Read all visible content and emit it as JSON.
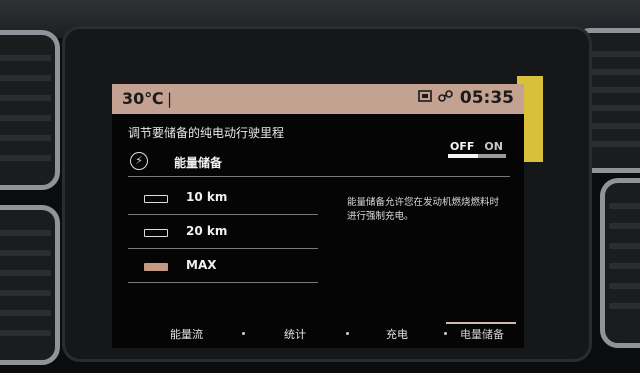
{
  "status": {
    "temperature": "30℃",
    "separator": "|",
    "time": "05:35",
    "icons": [
      "display-icon",
      "link-icon"
    ]
  },
  "title": "调节要储备的纯电动行驶里程",
  "energy_reserve": {
    "label": "能量储备",
    "icon": "lightning-icon",
    "toggle_off": "OFF",
    "toggle_on": "ON",
    "state": "OFF"
  },
  "options": [
    {
      "label": "10 km",
      "selected": false
    },
    {
      "label": "20 km",
      "selected": false
    },
    {
      "label": "MAX",
      "selected": true
    }
  ],
  "description": "能量储备允许您在发动机燃烧燃料时进行强制充电。",
  "tabs": [
    {
      "label": "能量流"
    },
    {
      "label": "统计"
    },
    {
      "label": "充电"
    },
    {
      "label": "电量储备",
      "active": true
    }
  ],
  "colors": {
    "status_bar": "#c4a292",
    "accent": "#c59a85"
  }
}
